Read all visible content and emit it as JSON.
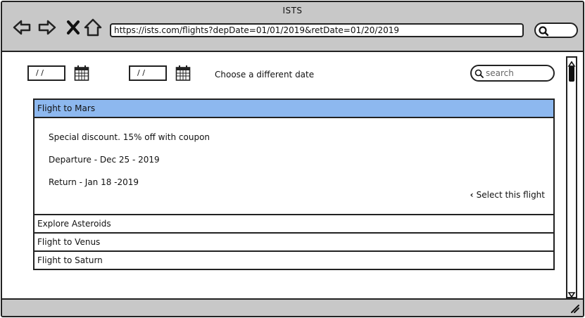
{
  "window": {
    "title": "ISTS"
  },
  "browser": {
    "url": "https://ists.com/flights?depDate=01/01/2019&retDate=01/20/2019",
    "nav_icons": [
      "back-arrow-icon",
      "forward-arrow-icon",
      "close-x-icon",
      "home-icon"
    ]
  },
  "filters": {
    "dep_date": "/ /",
    "ret_date": "/ /",
    "choose_text": "Choose a different date",
    "search_placeholder": "search"
  },
  "flights": [
    {
      "title": "Flight to Mars",
      "expanded": true,
      "details": {
        "discount": "Special discount. 15% off with coupon",
        "departure": "Departure - Dec 25 - 2019",
        "return": "Return - Jan 18 -2019",
        "select_label": "Select this flight"
      }
    },
    {
      "title": "Explore Asteroids",
      "expanded": false
    },
    {
      "title": "Flight to Venus",
      "expanded": false
    },
    {
      "title": "Flight to Saturn",
      "expanded": false
    }
  ],
  "colors": {
    "active_header": "#8db8ef",
    "chrome": "#c8c8c8"
  }
}
